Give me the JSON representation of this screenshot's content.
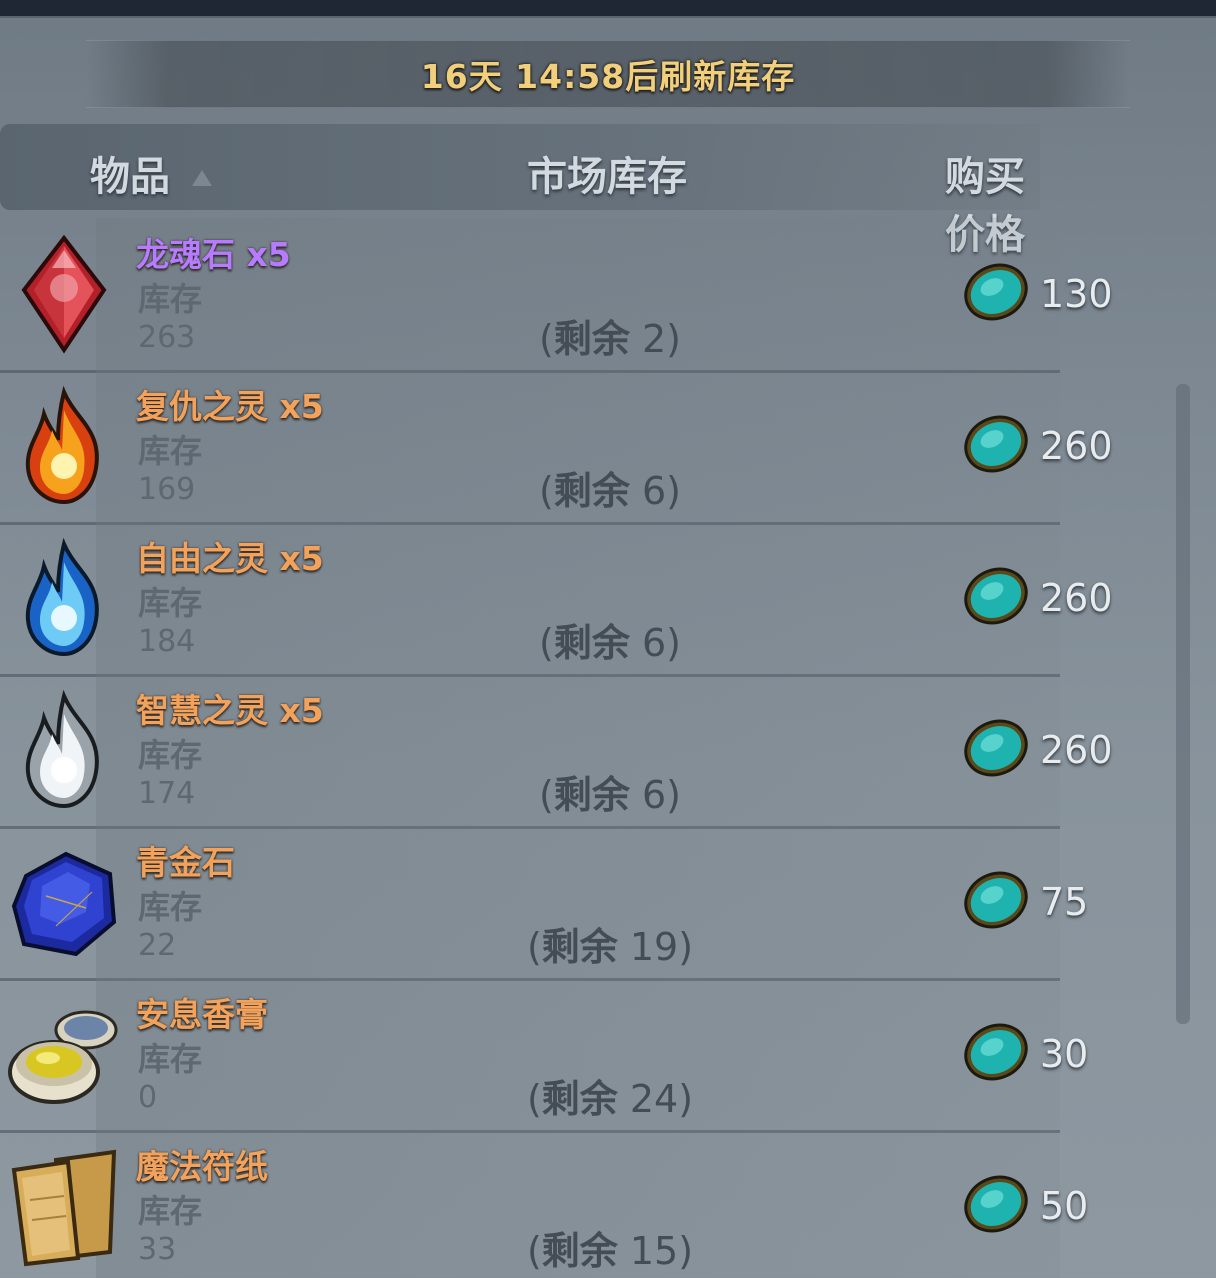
{
  "banner": {
    "text": "16天 14:58后刷新库存"
  },
  "header": {
    "item": "物品",
    "stock": "市场库存",
    "price": "购买价格"
  },
  "items": [
    {
      "name": "龙魂石 x5",
      "color": "#b77bff",
      "stock_label": "库存",
      "stock": "263",
      "remain_prefix": "(",
      "remain_word": "剩余",
      "remain_value": " 2)",
      "price": "130",
      "icon": "red-crystal-icon"
    },
    {
      "name": "复仇之灵 x5",
      "color": "#f2a25a",
      "stock_label": "库存",
      "stock": "169",
      "remain_prefix": "(",
      "remain_word": "剩余",
      "remain_value": " 6)",
      "price": "260",
      "icon": "orange-flame-icon"
    },
    {
      "name": "自由之灵 x5",
      "color": "#f2a25a",
      "stock_label": "库存",
      "stock": "184",
      "remain_prefix": "(",
      "remain_word": "剩余",
      "remain_value": " 6)",
      "price": "260",
      "icon": "blue-flame-icon"
    },
    {
      "name": "智慧之灵 x5",
      "color": "#f2a25a",
      "stock_label": "库存",
      "stock": "174",
      "remain_prefix": "(",
      "remain_word": "剩余",
      "remain_value": " 6)",
      "price": "260",
      "icon": "white-flame-icon"
    },
    {
      "name": "青金石",
      "color": "#f2a25a",
      "stock_label": "库存",
      "stock": "22",
      "remain_prefix": "(",
      "remain_word": "剩余",
      "remain_value": " 19)",
      "price": "75",
      "icon": "lapis-stone-icon"
    },
    {
      "name": "安息香膏",
      "color": "#f2a25a",
      "stock_label": "库存",
      "stock": "0",
      "remain_prefix": "(",
      "remain_word": "剩余",
      "remain_value": " 24)",
      "price": "30",
      "icon": "salve-jar-icon"
    },
    {
      "name": "魔法符纸",
      "color": "#f2a25a",
      "stock_label": "库存",
      "stock": "33",
      "remain_prefix": "(",
      "remain_word": "剩余",
      "remain_value": " 15)",
      "price": "50",
      "icon": "talisman-paper-icon"
    }
  ],
  "currency_icon": "turquoise-gem-icon"
}
